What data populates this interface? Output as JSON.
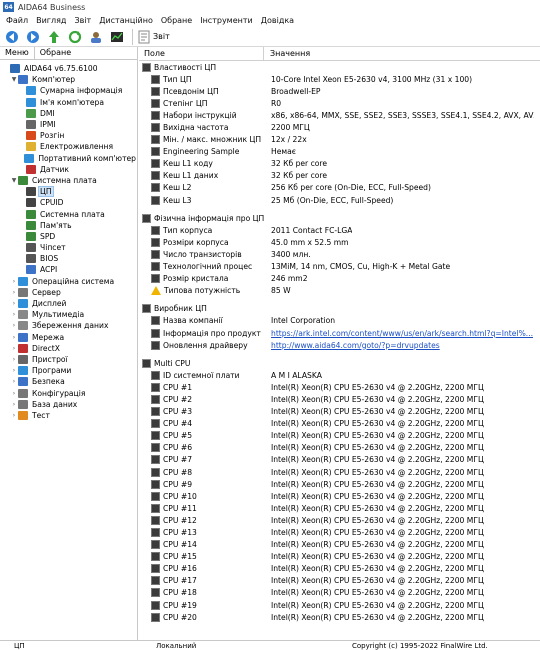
{
  "window": {
    "title": "AIDA64 Business",
    "app_icon_text": "64"
  },
  "menu": [
    "Файл",
    "Вигляд",
    "Звіт",
    "Дистанційно",
    "Обране",
    "Інструменти",
    "Довідка"
  ],
  "toolbar": {
    "report_label": "Звіт"
  },
  "left_tabs": {
    "menu": "Меню",
    "favorites": "Обране"
  },
  "tree": [
    {
      "label": "AIDA64 v6.75.6100",
      "indent": 0,
      "exp": "",
      "icon": "#2d6bb5",
      "name": "aida64-root"
    },
    {
      "label": "Комп'ютер",
      "indent": 1,
      "exp": "▼",
      "icon": "#3d73c7",
      "name": "computer"
    },
    {
      "label": "Сумарна інформація",
      "indent": 2,
      "exp": "",
      "icon": "#2f8fd8",
      "name": "summary"
    },
    {
      "label": "Ім'я комп'ютера",
      "indent": 2,
      "exp": "",
      "icon": "#2f8fd8",
      "name": "computer-name"
    },
    {
      "label": "DMI",
      "indent": 2,
      "exp": "",
      "icon": "#4a9a4a",
      "name": "dmi"
    },
    {
      "label": "IPMI",
      "indent": 2,
      "exp": "",
      "icon": "#666666",
      "name": "ipmi"
    },
    {
      "label": "Розгін",
      "indent": 2,
      "exp": "",
      "icon": "#d84a1b",
      "name": "overclock"
    },
    {
      "label": "Електроживлення",
      "indent": 2,
      "exp": "",
      "icon": "#e0b030",
      "name": "power"
    },
    {
      "label": "Портативний комп'ютер",
      "indent": 2,
      "exp": "",
      "icon": "#2f8fd8",
      "name": "portable"
    },
    {
      "label": "Датчик",
      "indent": 2,
      "exp": "",
      "icon": "#c03030",
      "name": "sensor"
    },
    {
      "label": "Системна плата",
      "indent": 1,
      "exp": "▼",
      "icon": "#3b8a3b",
      "name": "motherboard"
    },
    {
      "label": "ЦП",
      "indent": 2,
      "exp": "",
      "icon": "#444444",
      "name": "cpu",
      "selected": true
    },
    {
      "label": "CPUID",
      "indent": 2,
      "exp": "",
      "icon": "#444444",
      "name": "cpuid"
    },
    {
      "label": "Системна плата",
      "indent": 2,
      "exp": "",
      "icon": "#3b8a3b",
      "name": "motherboard-sub"
    },
    {
      "label": "Пам'ять",
      "indent": 2,
      "exp": "",
      "icon": "#3b8a3b",
      "name": "memory"
    },
    {
      "label": "SPD",
      "indent": 2,
      "exp": "",
      "icon": "#3b8a3b",
      "name": "spd"
    },
    {
      "label": "Чіпсет",
      "indent": 2,
      "exp": "",
      "icon": "#555555",
      "name": "chipset"
    },
    {
      "label": "BIOS",
      "indent": 2,
      "exp": "",
      "icon": "#555555",
      "name": "bios"
    },
    {
      "label": "ACPI",
      "indent": 2,
      "exp": "",
      "icon": "#3d73c7",
      "name": "acpi"
    },
    {
      "label": "Операційна система",
      "indent": 1,
      "exp": "›",
      "icon": "#2f8fd8",
      "name": "os"
    },
    {
      "label": "Сервер",
      "indent": 1,
      "exp": "›",
      "icon": "#777777",
      "name": "server"
    },
    {
      "label": "Дисплей",
      "indent": 1,
      "exp": "›",
      "icon": "#2f8fd8",
      "name": "display"
    },
    {
      "label": "Мультимедіа",
      "indent": 1,
      "exp": "›",
      "icon": "#888888",
      "name": "multimedia"
    },
    {
      "label": "Збереження даних",
      "indent": 1,
      "exp": "›",
      "icon": "#888888",
      "name": "storage"
    },
    {
      "label": "Мережа",
      "indent": 1,
      "exp": "›",
      "icon": "#3d73c7",
      "name": "network"
    },
    {
      "label": "DirectX",
      "indent": 1,
      "exp": "›",
      "icon": "#c03030",
      "name": "directx"
    },
    {
      "label": "Пристрої",
      "indent": 1,
      "exp": "›",
      "icon": "#666666",
      "name": "devices"
    },
    {
      "label": "Програми",
      "indent": 1,
      "exp": "›",
      "icon": "#2f8fd8",
      "name": "programs"
    },
    {
      "label": "Безпека",
      "indent": 1,
      "exp": "›",
      "icon": "#3d73c7",
      "name": "security"
    },
    {
      "label": "Конфігурація",
      "indent": 1,
      "exp": "›",
      "icon": "#777777",
      "name": "config"
    },
    {
      "label": "База даних",
      "indent": 1,
      "exp": "›",
      "icon": "#777777",
      "name": "database"
    },
    {
      "label": "Тест",
      "indent": 1,
      "exp": "›",
      "icon": "#e08a20",
      "name": "test"
    }
  ],
  "columns": {
    "field": "Поле",
    "value": "Значення"
  },
  "sections": [
    {
      "title": "Властивості ЦП",
      "rows": [
        {
          "f": "Тип ЦП",
          "v": "10-Core Intel Xeon E5-2630 v4, 3100 MHz (31 x 100)"
        },
        {
          "f": "Псевдонім ЦП",
          "v": "Broadwell-EP"
        },
        {
          "f": "Степінг ЦП",
          "v": "R0"
        },
        {
          "f": "Набори інструкцій",
          "v": "x86, x86-64, MMX, SSE, SSE2, SSE3, SSSE3, SSE4.1, SSE4.2, AVX, AVX2, F..."
        },
        {
          "f": "Вихідна частота",
          "v": "2200 МГЦ"
        },
        {
          "f": "Мін. / макс. множник ЦП",
          "v": "12x / 22x"
        },
        {
          "f": "Engineering Sample",
          "v": "Немає"
        },
        {
          "f": "Кеш L1 коду",
          "v": "32 Кб per core"
        },
        {
          "f": "Кеш L1 даних",
          "v": "32 Кб per core"
        },
        {
          "f": "Кеш L2",
          "v": "256 Кб per core  (On-Die, ECC, Full-Speed)"
        },
        {
          "f": "Кеш L3",
          "v": "25 Мб  (On-Die, ECC, Full-Speed)"
        }
      ]
    },
    {
      "title": "Фізична інформація про ЦП",
      "rows": [
        {
          "f": "Тип корпуса",
          "v": "2011 Contact FC-LGA"
        },
        {
          "f": "Розміри корпуса",
          "v": "45.0 mm x 52.5 mm"
        },
        {
          "f": "Число транзисторів",
          "v": "3400 млн."
        },
        {
          "f": "Технологічний процес",
          "v": "13MiM, 14 nm, CMOS, Cu, High-K + Metal Gate"
        },
        {
          "f": "Розмір кристала",
          "v": "246 mm2"
        },
        {
          "f": "Типова потужність",
          "v": "85 W",
          "warn": true
        }
      ]
    },
    {
      "title": "Виробник ЦП",
      "rows": [
        {
          "f": "Назва компанії",
          "v": "Intel Corporation"
        },
        {
          "f": "Інформація про продукт",
          "v": "https://ark.intel.com/content/www/us/en/ark/search.html?q=Intel%...",
          "link": true
        },
        {
          "f": "Оновлення драйверу",
          "v": "http://www.aida64.com/goto/?p=drvupdates",
          "link": true
        }
      ]
    },
    {
      "title": "Multi CPU",
      "rows": [
        {
          "f": "ID системної плати",
          "v": "A M I ALASKA"
        },
        {
          "f": "CPU #1",
          "v": "Intel(R) Xeon(R) CPU E5-2630 v4 @ 2.20GHz, 2200 МГЦ"
        },
        {
          "f": "CPU #2",
          "v": "Intel(R) Xeon(R) CPU E5-2630 v4 @ 2.20GHz, 2200 МГЦ"
        },
        {
          "f": "CPU #3",
          "v": "Intel(R) Xeon(R) CPU E5-2630 v4 @ 2.20GHz, 2200 МГЦ"
        },
        {
          "f": "CPU #4",
          "v": "Intel(R) Xeon(R) CPU E5-2630 v4 @ 2.20GHz, 2200 МГЦ"
        },
        {
          "f": "CPU #5",
          "v": "Intel(R) Xeon(R) CPU E5-2630 v4 @ 2.20GHz, 2200 МГЦ"
        },
        {
          "f": "CPU #6",
          "v": "Intel(R) Xeon(R) CPU E5-2630 v4 @ 2.20GHz, 2200 МГЦ"
        },
        {
          "f": "CPU #7",
          "v": "Intel(R) Xeon(R) CPU E5-2630 v4 @ 2.20GHz, 2200 МГЦ"
        },
        {
          "f": "CPU #8",
          "v": "Intel(R) Xeon(R) CPU E5-2630 v4 @ 2.20GHz, 2200 МГЦ"
        },
        {
          "f": "CPU #9",
          "v": "Intel(R) Xeon(R) CPU E5-2630 v4 @ 2.20GHz, 2200 МГЦ"
        },
        {
          "f": "CPU #10",
          "v": "Intel(R) Xeon(R) CPU E5-2630 v4 @ 2.20GHz, 2200 МГЦ"
        },
        {
          "f": "CPU #11",
          "v": "Intel(R) Xeon(R) CPU E5-2630 v4 @ 2.20GHz, 2200 МГЦ"
        },
        {
          "f": "CPU #12",
          "v": "Intel(R) Xeon(R) CPU E5-2630 v4 @ 2.20GHz, 2200 МГЦ"
        },
        {
          "f": "CPU #13",
          "v": "Intel(R) Xeon(R) CPU E5-2630 v4 @ 2.20GHz, 2200 МГЦ"
        },
        {
          "f": "CPU #14",
          "v": "Intel(R) Xeon(R) CPU E5-2630 v4 @ 2.20GHz, 2200 МГЦ"
        },
        {
          "f": "CPU #15",
          "v": "Intel(R) Xeon(R) CPU E5-2630 v4 @ 2.20GHz, 2200 МГЦ"
        },
        {
          "f": "CPU #16",
          "v": "Intel(R) Xeon(R) CPU E5-2630 v4 @ 2.20GHz, 2200 МГЦ"
        },
        {
          "f": "CPU #17",
          "v": "Intel(R) Xeon(R) CPU E5-2630 v4 @ 2.20GHz, 2200 МГЦ"
        },
        {
          "f": "CPU #18",
          "v": "Intel(R) Xeon(R) CPU E5-2630 v4 @ 2.20GHz, 2200 МГЦ"
        },
        {
          "f": "CPU #19",
          "v": "Intel(R) Xeon(R) CPU E5-2630 v4 @ 2.20GHz, 2200 МГЦ"
        },
        {
          "f": "CPU #20",
          "v": "Intel(R) Xeon(R) CPU E5-2630 v4 @ 2.20GHz, 2200 МГЦ"
        }
      ]
    }
  ],
  "status": {
    "left": "ЦП",
    "mid": "Локальний",
    "right": "Copyright (c) 1995-2022 FinalWire Ltd."
  }
}
